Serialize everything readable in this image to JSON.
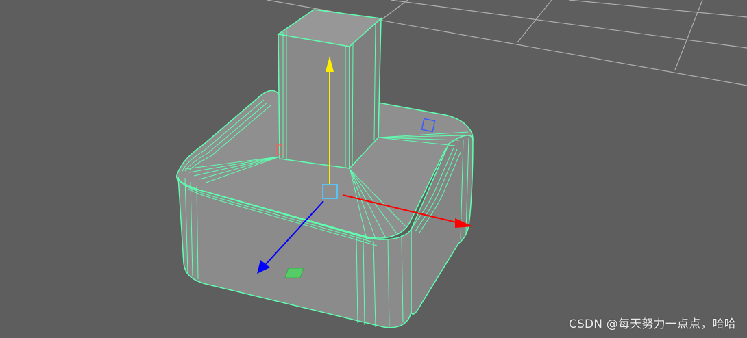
{
  "viewport": {
    "background_color": "#5e5e5e",
    "grid_color": "#bdbdbd"
  },
  "model": {
    "face_color": "#8c8c8c",
    "face_dark_color": "#7f7f7f",
    "wire_color": "#5fffb0",
    "wire_dark_color": "#3fd98f"
  },
  "manipulator": {
    "y_axis_color": "#ffee00",
    "x_axis_color": "#ff0000",
    "z_axis_color": "#0000ff",
    "center_handle_color": "#55c8ff",
    "icons": [
      "move-y-arrow-icon",
      "move-x-arrow-icon",
      "move-z-arrow-icon",
      "center-handle-icon"
    ]
  },
  "watermark": {
    "text": "CSDN @每天努力一点点，哈哈"
  }
}
